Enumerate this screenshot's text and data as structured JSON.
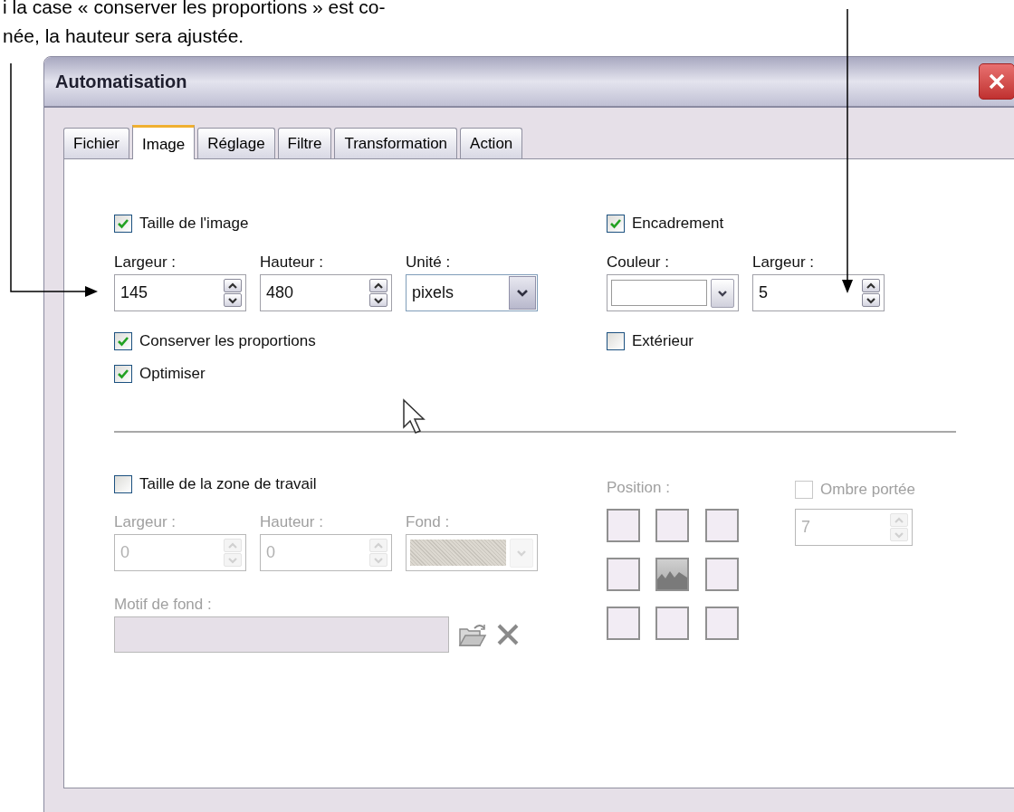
{
  "annotation": {
    "lines": [
      "i la case « conserver les proportions » est co-",
      "née, la hauteur sera ajustée."
    ]
  },
  "window": {
    "title": "Automatisation"
  },
  "tabs": [
    {
      "label": "Fichier",
      "selected": false
    },
    {
      "label": "Image",
      "selected": true
    },
    {
      "label": "Réglage",
      "selected": false
    },
    {
      "label": "Filtre",
      "selected": false
    },
    {
      "label": "Transformation",
      "selected": false
    },
    {
      "label": "Action",
      "selected": false
    }
  ],
  "image_size": {
    "label": "Taille de l'image",
    "checked": true,
    "fields": [
      {
        "kind": "spin",
        "label": "Largeur :",
        "value": "145"
      },
      {
        "kind": "spin",
        "label": "Hauteur :",
        "value": "480"
      },
      {
        "kind": "select",
        "label": "Unité :",
        "value": "pixels"
      }
    ],
    "options": [
      {
        "label": "Conserver les proportions",
        "checked": true
      },
      {
        "label": "Optimiser",
        "checked": true
      }
    ]
  },
  "frame": {
    "label": "Encadrement",
    "checked": true,
    "fields": [
      {
        "kind": "color",
        "label": "Couleur :"
      },
      {
        "kind": "spin",
        "label": "Largeur :",
        "value": "5"
      }
    ],
    "options": [
      {
        "label": "Extérieur",
        "checked": false
      }
    ]
  },
  "canvas_size": {
    "label": "Taille de la zone de travail",
    "checked": false,
    "fields": [
      {
        "kind": "spin",
        "label": "Largeur :",
        "value": "0"
      },
      {
        "kind": "spin",
        "label": "Hauteur :",
        "value": "0"
      },
      {
        "kind": "pattern",
        "label": "Fond :"
      }
    ],
    "background_pattern": {
      "label": "Motif de fond :"
    },
    "position": {
      "label": "Position :",
      "cells": [
        {
          "selected": false
        },
        {
          "selected": false
        },
        {
          "selected": false
        },
        {
          "selected": false
        },
        {
          "selected": true
        },
        {
          "selected": false
        },
        {
          "selected": false
        },
        {
          "selected": false
        },
        {
          "selected": false
        }
      ]
    },
    "drop_shadow": {
      "label": "Ombre portée",
      "checked": false,
      "value": "7"
    }
  }
}
